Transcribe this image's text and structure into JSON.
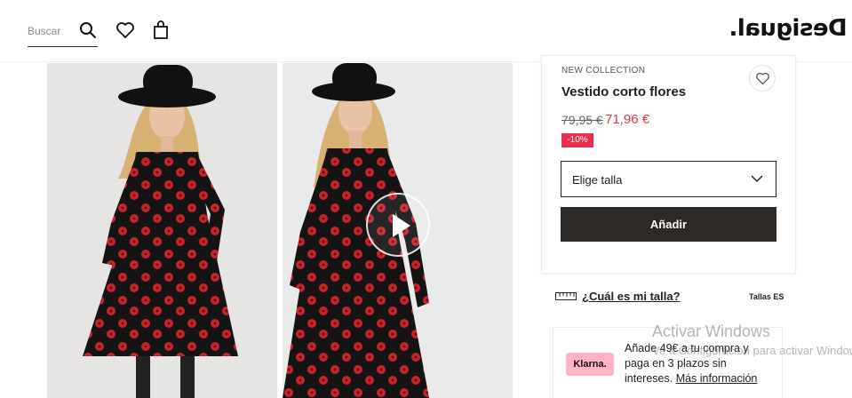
{
  "header": {
    "search_placeholder": "Buscar",
    "brand": "Desigual."
  },
  "product": {
    "collection": "NEW COLLECTION",
    "title": "Vestido corto flores",
    "old_price": "79,95 €",
    "new_price": "71,96 €",
    "discount": "-10%",
    "size_select_label": "Elige talla",
    "add_label": "Añadir"
  },
  "size_guide": {
    "link": "¿Cuál es mi talla?",
    "region": "Tallas ES"
  },
  "klarna": {
    "badge": "Klarna.",
    "text": "Añade 49€ a tu compra y paga en 3 plazos sin intereses.",
    "link": "Más información"
  },
  "watermark": {
    "title": "Activar Windows",
    "subtitle": "Ve a Configuración para activar Windows."
  },
  "colors": {
    "accent_price": "#d9374a",
    "discount_bg": "#e8304b",
    "button_bg": "#2d2926",
    "klarna_pink": "#ffb3c7",
    "dress_red": "#c8232c"
  },
  "icons": [
    "search-icon",
    "heart-icon",
    "shopping-bag-icon",
    "play-icon",
    "chevron-down-icon",
    "ruler-icon"
  ]
}
